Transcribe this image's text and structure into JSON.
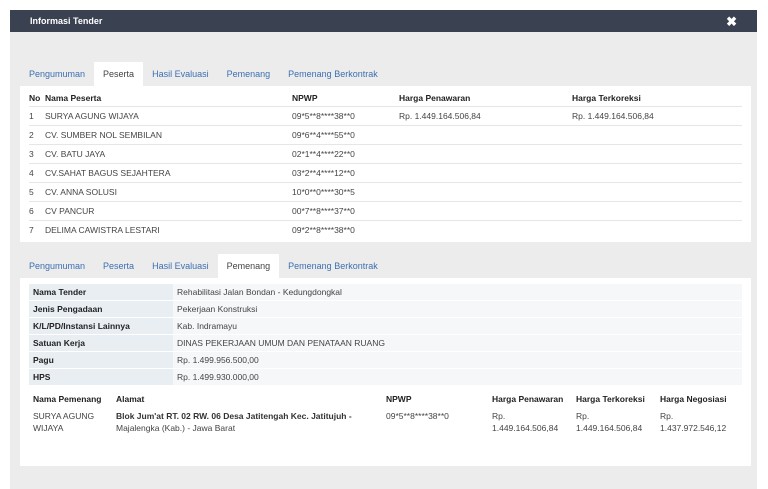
{
  "window": {
    "title": "Informasi Tender",
    "close_label": "✖"
  },
  "tabs": [
    "Pengumuman",
    "Peserta",
    "Hasil Evaluasi",
    "Pemenang",
    "Pemenang Berkontrak"
  ],
  "peserta": {
    "headers": [
      "No",
      "Nama Peserta",
      "NPWP",
      "Harga Penawaran",
      "Harga Terkoreksi"
    ],
    "rows": [
      [
        "1",
        "SURYA AGUNG WIJAYA",
        "09*5**8****38**0",
        "Rp. 1.449.164.506,84",
        "Rp. 1.449.164.506,84"
      ],
      [
        "2",
        "CV. SUMBER NOL SEMBILAN",
        "09*6**4****55**0",
        "",
        ""
      ],
      [
        "3",
        "CV. BATU JAYA",
        "02*1**4****22**0",
        "",
        ""
      ],
      [
        "4",
        "CV.SAHAT BAGUS SEJAHTERA",
        "03*2**4****12**0",
        "",
        ""
      ],
      [
        "5",
        "CV. ANNA SOLUSI",
        "10*0**0****30**5",
        "",
        ""
      ],
      [
        "6",
        "CV PANCUR",
        "00*7**8****37**0",
        "",
        ""
      ],
      [
        "7",
        "DELIMA CAWISTRA LESTARI",
        "09*2**8****38**0",
        "",
        ""
      ]
    ]
  },
  "pemenang": {
    "info": [
      [
        "Nama Tender",
        "Rehabilitasi Jalan Bondan - Kedungdongkal"
      ],
      [
        "Jenis Pengadaan",
        "Pekerjaan Konstruksi"
      ],
      [
        "K/L/PD/Instansi Lainnya",
        "Kab. Indramayu"
      ],
      [
        "Satuan Kerja",
        "DINAS PEKERJAAN UMUM DAN PENATAAN RUANG"
      ],
      [
        "Pagu",
        "Rp. 1.499.956.500,00"
      ],
      [
        "HPS",
        "Rp. 1.499.930.000,00"
      ]
    ],
    "headers": [
      "Nama Pemenang",
      "Alamat",
      "NPWP",
      "Harga Penawaran",
      "Harga Terkoreksi",
      "Harga Negosiasi"
    ],
    "winner": {
      "nama": "SURYA AGUNG WIJAYA",
      "alamat_bold": "Blok Jum'at RT. 02 RW. 06 Desa Jatitengah Kec. Jatitujuh -",
      "alamat_rest": "Majalengka (Kab.) - Jawa Barat",
      "npwp": "09*5**8****38**0",
      "penawaran_prefix": "Rp.",
      "penawaran": "1.449.164.506,84",
      "terkoreksi_prefix": "Rp.",
      "terkoreksi": "1.449.164.506,84",
      "negosiasi_prefix": "Rp.",
      "negosiasi": "1.437.972.546,12"
    }
  }
}
